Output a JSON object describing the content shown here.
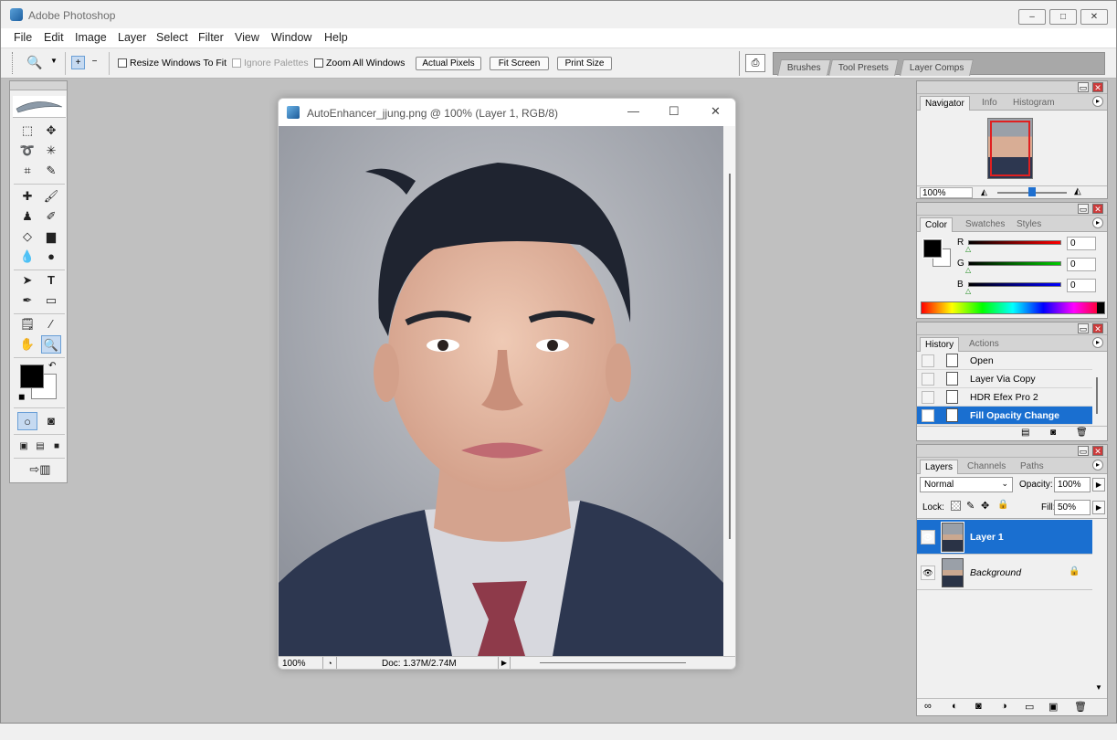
{
  "app": {
    "title": "Adobe Photoshop"
  },
  "window_controls": {
    "minimize": "–",
    "maximize": "□",
    "close": "✕"
  },
  "menu": [
    "File",
    "Edit",
    "Image",
    "Layer",
    "Select",
    "Filter",
    "View",
    "Window",
    "Help"
  ],
  "options_bar": {
    "resize_windows": "Resize Windows To Fit",
    "ignore_palettes": "Ignore Palettes",
    "zoom_all": "Zoom All Windows",
    "actual_pixels": "Actual Pixels",
    "fit_screen": "Fit Screen",
    "print_size": "Print Size",
    "well_tabs": [
      "Brushes",
      "Tool Presets",
      "Layer Comps"
    ]
  },
  "document": {
    "title": "AutoEnhancer_jjung.png @ 100% (Layer 1, RGB/8)",
    "zoom": "100%",
    "doc_info": "Doc: 1.37M/2.74M"
  },
  "navigator": {
    "tabs": [
      "Navigator",
      "Info",
      "Histogram"
    ],
    "zoom": "100%",
    "slider_fraction": 0.5
  },
  "color": {
    "tabs": [
      "Color",
      "Swatches",
      "Styles"
    ],
    "channels": [
      {
        "label": "R",
        "value": "0"
      },
      {
        "label": "G",
        "value": "0"
      },
      {
        "label": "B",
        "value": "0"
      }
    ],
    "foreground": "#000000",
    "background": "#ffffff"
  },
  "history": {
    "tabs": [
      "History",
      "Actions"
    ],
    "items": [
      "Open",
      "Layer Via Copy",
      "HDR Efex Pro 2",
      "Fill Opacity Change"
    ],
    "selected_index": 3
  },
  "layers": {
    "tabs": [
      "Layers",
      "Channels",
      "Paths"
    ],
    "blend_mode": "Normal",
    "opacity_label": "Opacity:",
    "opacity": "100%",
    "lock_label": "Lock:",
    "fill_label": "Fill:",
    "fill": "50%",
    "items": [
      {
        "name": "Layer 1",
        "selected": true
      },
      {
        "name": "Background",
        "selected": false
      }
    ]
  },
  "colors": {
    "selection": "#1a6fd0",
    "accent": "#1d6fd0"
  }
}
